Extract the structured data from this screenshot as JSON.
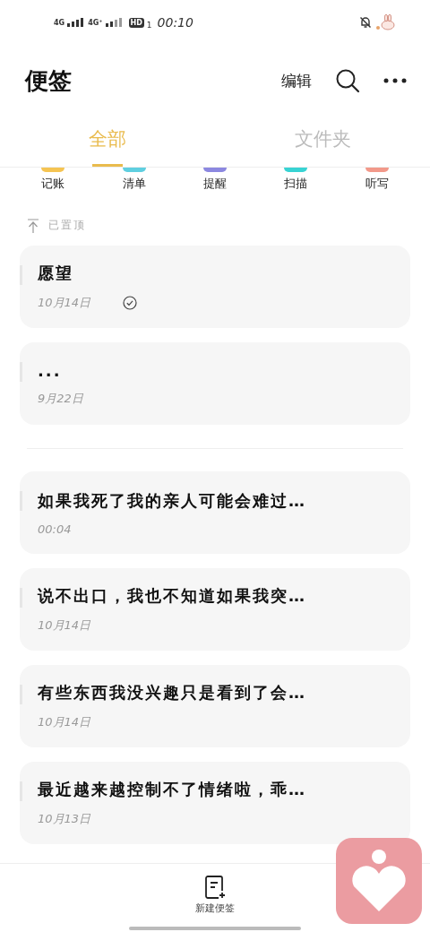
{
  "status_bar": {
    "network_1": "4G",
    "network_2": "4G⁺",
    "hd": "HD",
    "sim": "1",
    "time": "00:10"
  },
  "header": {
    "title": "便签",
    "edit": "编辑"
  },
  "tabs": [
    {
      "label": "全部",
      "selected": true
    },
    {
      "label": "文件夹",
      "selected": false
    }
  ],
  "shortcuts": [
    {
      "label": "记账",
      "color": "#f5c452"
    },
    {
      "label": "清单",
      "color": "#5fcfe0"
    },
    {
      "label": "提醒",
      "color": "#8c88e0"
    },
    {
      "label": "扫描",
      "color": "#38d3d3"
    },
    {
      "label": "听写",
      "color": "#f2998a"
    }
  ],
  "pinned": {
    "label": "已置顶",
    "notes": [
      {
        "title": "愿望",
        "date": "10月14日",
        "done": true
      },
      {
        "title": "...",
        "date": "9月22日",
        "done": false
      }
    ]
  },
  "notes": [
    {
      "title": "如果我死了我的亲人可能会难过…",
      "date": "00:04",
      "done": false
    },
    {
      "title": "说不出口，我也不知道如果我突…",
      "date": "10月14日",
      "done": false
    },
    {
      "title": "有些东西我没兴趣只是看到了会…",
      "date": "10月14日",
      "done": false
    },
    {
      "title": "最近越来越控制不了情绪啦，乖…",
      "date": "10月13日",
      "done": false
    }
  ],
  "bottom_bar": {
    "new_note": "新建便签"
  }
}
